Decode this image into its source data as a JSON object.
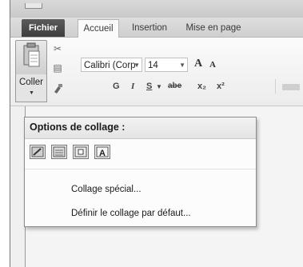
{
  "tabs": {
    "fichier": "Fichier",
    "accueil": "Accueil",
    "insertion": "Insertion",
    "mise_en_page": "Mise en page"
  },
  "clipboard": {
    "paste_label": "Coller"
  },
  "font": {
    "name": "Calibri (Corp",
    "size": "14",
    "grow_glyph": "A",
    "shrink_glyph": "A",
    "bold": "G",
    "italic": "I",
    "underline": "S",
    "strike": "abe",
    "subscript": "x₂",
    "superscript": "x²"
  },
  "paste_menu": {
    "header": "Options de collage :",
    "special": "Collage spécial...",
    "default": "Définir le collage par défaut..."
  }
}
